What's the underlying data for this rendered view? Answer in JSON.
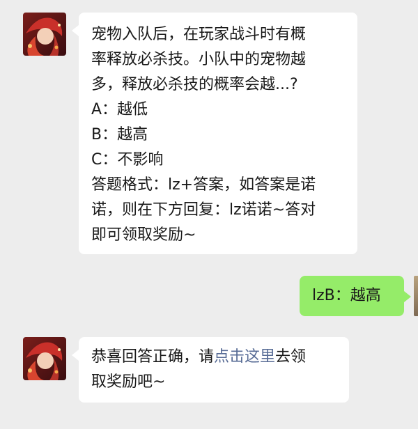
{
  "messages": [
    {
      "sender": "other",
      "lines": [
        "宠物入队后，在玩家战斗时有概",
        "率释放必杀技。小队中的宠物越",
        "多，释放必杀技的概率会越...?",
        "A：越低",
        "B：越高",
        "C：不影响",
        "答题格式：lz+答案，如答案是诺",
        "诺，则在下方回复：lz诺诺~答对",
        "即可领取奖励~"
      ]
    },
    {
      "sender": "self",
      "text": "lzB：越高"
    },
    {
      "sender": "other",
      "line1_before": "恭喜回答正确，请",
      "line1_link": "点击这里",
      "line1_after": "去领",
      "line2": "取奖励吧~"
    }
  ],
  "colors": {
    "background": "#ededed",
    "incoming_bubble": "#ffffff",
    "outgoing_bubble": "#95ec69",
    "link": "#576b95"
  }
}
